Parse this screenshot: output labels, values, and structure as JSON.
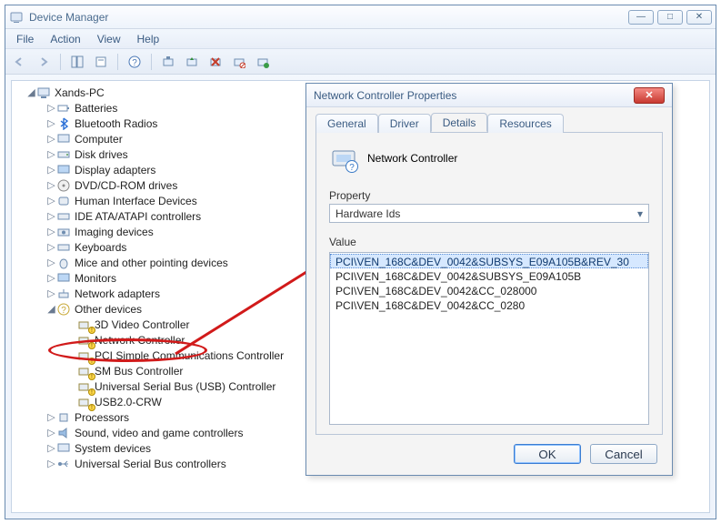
{
  "window": {
    "title": "Device Manager"
  },
  "menu": {
    "file": "File",
    "action": "Action",
    "view": "View",
    "help": "Help"
  },
  "tree": {
    "root": "Xands-PC",
    "batteries": "Batteries",
    "bluetooth": "Bluetooth Radios",
    "computer": "Computer",
    "disk": "Disk drives",
    "display": "Display adapters",
    "dvd": "DVD/CD-ROM drives",
    "hid": "Human Interface Devices",
    "ide": "IDE ATA/ATAPI controllers",
    "imaging": "Imaging devices",
    "keyboards": "Keyboards",
    "mice": "Mice and other pointing devices",
    "monitors": "Monitors",
    "netadapters": "Network adapters",
    "other": "Other devices",
    "other_items": {
      "vid3d": "3D Video Controller",
      "netctrl": "Network Controller",
      "pcisimple": "PCI Simple Communications Controller",
      "smbus": "SM Bus Controller",
      "usbctrl": "Universal Serial Bus (USB) Controller",
      "usb2crw": "USB2.0-CRW"
    },
    "processors": "Processors",
    "sound": "Sound, video and game controllers",
    "system": "System devices",
    "usb": "Universal Serial Bus controllers"
  },
  "dialog": {
    "title": "Network Controller Properties",
    "tabs": {
      "general": "General",
      "driver": "Driver",
      "details": "Details",
      "resources": "Resources"
    },
    "device_name": "Network Controller",
    "property_label": "Property",
    "property_value": "Hardware Ids",
    "value_label": "Value",
    "values": [
      "PCI\\VEN_168C&DEV_0042&SUBSYS_E09A105B&REV_30",
      "PCI\\VEN_168C&DEV_0042&SUBSYS_E09A105B",
      "PCI\\VEN_168C&DEV_0042&CC_028000",
      "PCI\\VEN_168C&DEV_0042&CC_0280"
    ],
    "ok": "OK",
    "cancel": "Cancel"
  }
}
